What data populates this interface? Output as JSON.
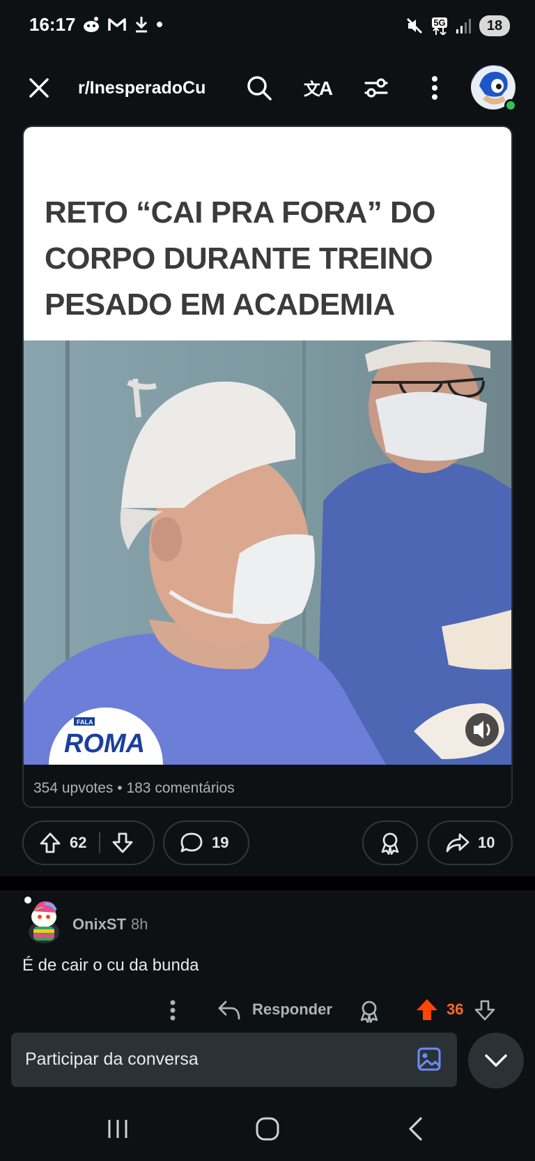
{
  "status_bar": {
    "time": "16:17",
    "left_icons": [
      "reddit-icon",
      "gmail-icon",
      "download-icon",
      "dot-icon"
    ],
    "right_icons": [
      "mute-icon",
      "5g-signal-icon",
      "signal-bars-icon"
    ],
    "network": "5G",
    "battery": "18"
  },
  "header": {
    "subreddit": "r/InesperadoCu",
    "icons": [
      "close-icon",
      "search-icon",
      "translate-icon",
      "filter-icon",
      "more-icon",
      "avatar"
    ]
  },
  "post": {
    "headline": "RETO “CAI PRA FORA” DO CORPO DURANTE TREINO PESADO EM ACADEMIA",
    "watermark": "FALA ROMA",
    "stats": "354 upvotes • 183 comentários"
  },
  "actions": {
    "upvotes": "62",
    "comments": "19",
    "shares": "10"
  },
  "comment": {
    "username": "OnixST",
    "time": "8h",
    "text": "É de cair o cu da bunda",
    "reply_label": "Responder",
    "score": "36"
  },
  "compose": {
    "placeholder": "Participar da conversa"
  },
  "colors": {
    "background": "#0e1113",
    "upvote_active": "#ff4500",
    "score_active": "#ff6a2b",
    "online": "#36c05a",
    "image_icon": "#6b8cff"
  }
}
